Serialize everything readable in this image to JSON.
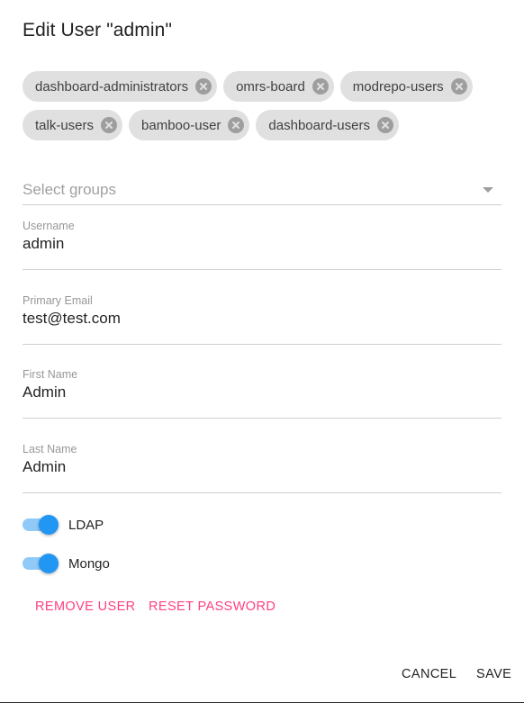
{
  "dialog": {
    "title": "Edit User \"admin\""
  },
  "groups": {
    "chips_row1": [
      {
        "label": "dashboard-administrators"
      },
      {
        "label": "omrs-board"
      },
      {
        "label": "modrepo-users"
      }
    ],
    "chips_row2": [
      {
        "label": "talk-users"
      },
      {
        "label": "bamboo-user"
      },
      {
        "label": "dashboard-users"
      }
    ],
    "select_placeholder": "Select groups",
    "chip_delete_icon": "cancel-circle-icon"
  },
  "fields": {
    "username": {
      "label": "Username",
      "value": "admin"
    },
    "email": {
      "label": "Primary Email",
      "value": "test@test.com"
    },
    "first_name": {
      "label": "First Name",
      "value": "Admin"
    },
    "last_name": {
      "label": "Last Name",
      "value": "Admin"
    }
  },
  "toggles": {
    "ldap": {
      "label": "LDAP",
      "on": true
    },
    "mongo": {
      "label": "Mongo",
      "on": true
    }
  },
  "actions": {
    "remove_user": "REMOVE USER",
    "reset_password": "RESET PASSWORD",
    "cancel": "CANCEL",
    "save": "SAVE"
  },
  "colors": {
    "accent": "#ff4081",
    "toggle_thumb": "#2196f3",
    "toggle_track": "#90caf9",
    "chip_bg": "#e0e0e0"
  }
}
